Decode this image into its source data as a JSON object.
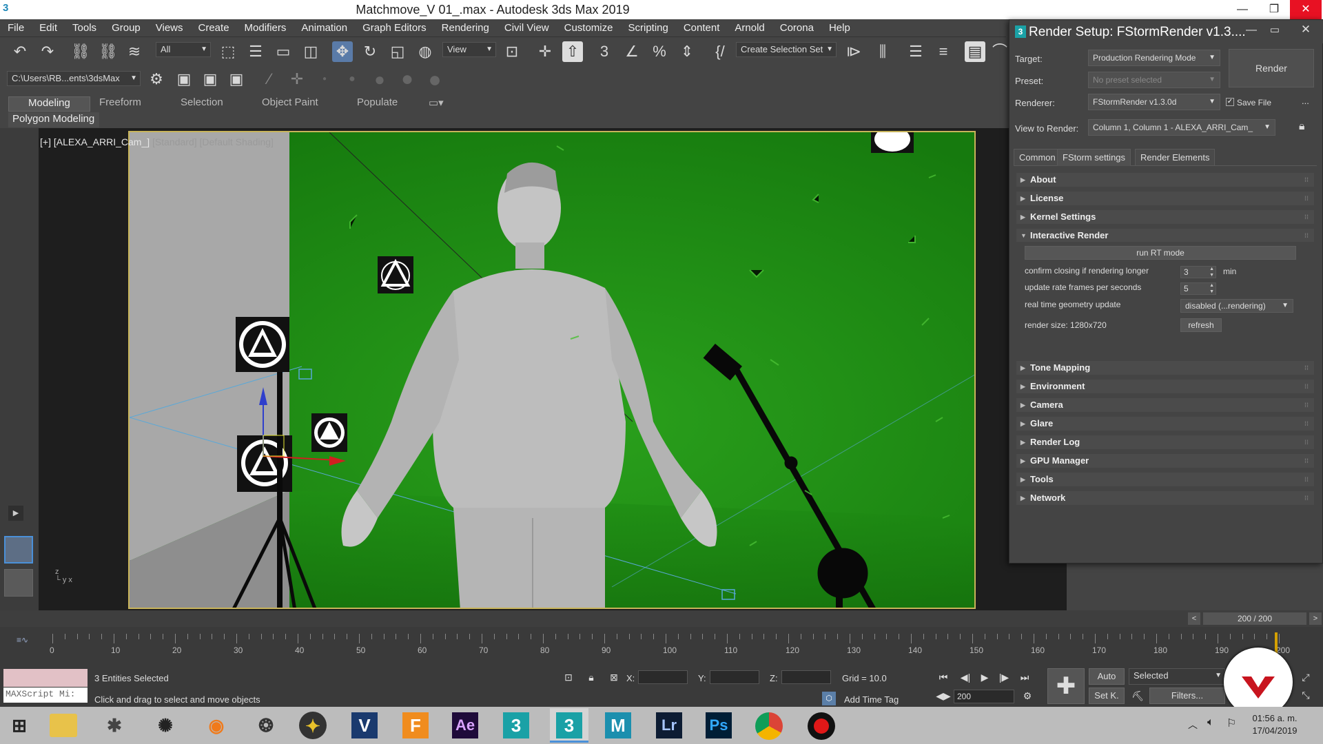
{
  "window": {
    "title": "Matchmove_V 01_.max - Autodesk 3ds Max 2019",
    "app_icon": "3"
  },
  "menu": [
    "File",
    "Edit",
    "Tools",
    "Group",
    "Views",
    "Create",
    "Modifiers",
    "Animation",
    "Graph Editors",
    "Rendering",
    "Civil View",
    "Customize",
    "Scripting",
    "Content",
    "Arnold",
    "Corona",
    "Help"
  ],
  "toolbar": {
    "filter_value": "All",
    "ref_coord_value": "View",
    "selection_set_value": "Create Selection Set",
    "project_path": "C:\\Users\\RB...ents\\3dsMax"
  },
  "ribbon": {
    "tabs": [
      "Modeling",
      "Freeform",
      "Selection",
      "Object Paint",
      "Populate"
    ],
    "active": "Modeling",
    "panel": "Polygon Modeling"
  },
  "viewport": {
    "label_main": "[+] [ALEXA_ARRI_Cam_]",
    "label_dim": "[Standard] [Default Shading]"
  },
  "timeline": {
    "frame_indicator": "200 / 200",
    "ticks": [
      "0",
      "10",
      "20",
      "30",
      "40",
      "50",
      "60",
      "70",
      "80",
      "90",
      "100",
      "110",
      "120",
      "130",
      "140",
      "150",
      "160",
      "170",
      "180",
      "190",
      "200"
    ]
  },
  "status": {
    "maxscript": "MAXScript Mi:",
    "selected_text": "3 Entities Selected",
    "prompt_text": "Click and drag to select and move objects",
    "x_label": "X:",
    "y_label": "Y:",
    "z_label": "Z:",
    "grid": "Grid = 10.0",
    "add_time_tag": "Add Time Tag",
    "frame_value": "200",
    "auto_key": "Auto",
    "set_key": "Set K.",
    "key_filter": "Selected",
    "filters": "Filters..."
  },
  "render_setup": {
    "title": "Render Setup: FStormRender v1.3....",
    "target_label": "Target:",
    "target_value": "Production Rendering Mode",
    "preset_label": "Preset:",
    "preset_value": "No preset selected",
    "renderer_label": "Renderer:",
    "renderer_value": "FStormRender v1.3.0d",
    "save_file": "Save File",
    "more": "...",
    "view_label": "View to Render:",
    "view_value": "Column 1, Column 1 - ALEXA_ARRI_Cam_",
    "render_button": "Render",
    "tabs": [
      "Common",
      "FStorm settings",
      "Render Elements"
    ],
    "active_tab": "FStorm settings",
    "rollouts_top": [
      "About",
      "License",
      "Kernel Settings"
    ],
    "interactive": {
      "title": "Interactive Render",
      "run_rt": "run RT mode",
      "confirm_label": "confirm closing if rendering longer",
      "confirm_value": "3",
      "confirm_unit": "min",
      "rate_label": "update rate frames per seconds",
      "rate_value": "5",
      "geom_label": "real time geometry update",
      "geom_value": "disabled (...rendering)",
      "size_label": "render size: 1280x720",
      "refresh": "refresh"
    },
    "rollouts_bottom": [
      "Tone Mapping",
      "Environment",
      "Camera",
      "Glare",
      "Render Log",
      "GPU Manager",
      "Tools",
      "Network"
    ]
  },
  "taskbar": {
    "apps": [
      "file-explorer",
      "blender-like",
      "davinci",
      "blender",
      "resolve",
      "maya-bonus",
      "vegas",
      "fusion",
      "after-effects",
      "3dsmax",
      "3dsmax-active",
      "maya",
      "lightroom",
      "photoshop",
      "chrome",
      "recorder"
    ],
    "labels": {
      "ae": "Ae",
      "lr": "Lr",
      "ps": "Ps",
      "v": "V",
      "f": "F",
      "m": "M",
      "max1": "3",
      "max2": "3"
    },
    "time": "01:56 a. m.",
    "date": "17/04/2019"
  }
}
